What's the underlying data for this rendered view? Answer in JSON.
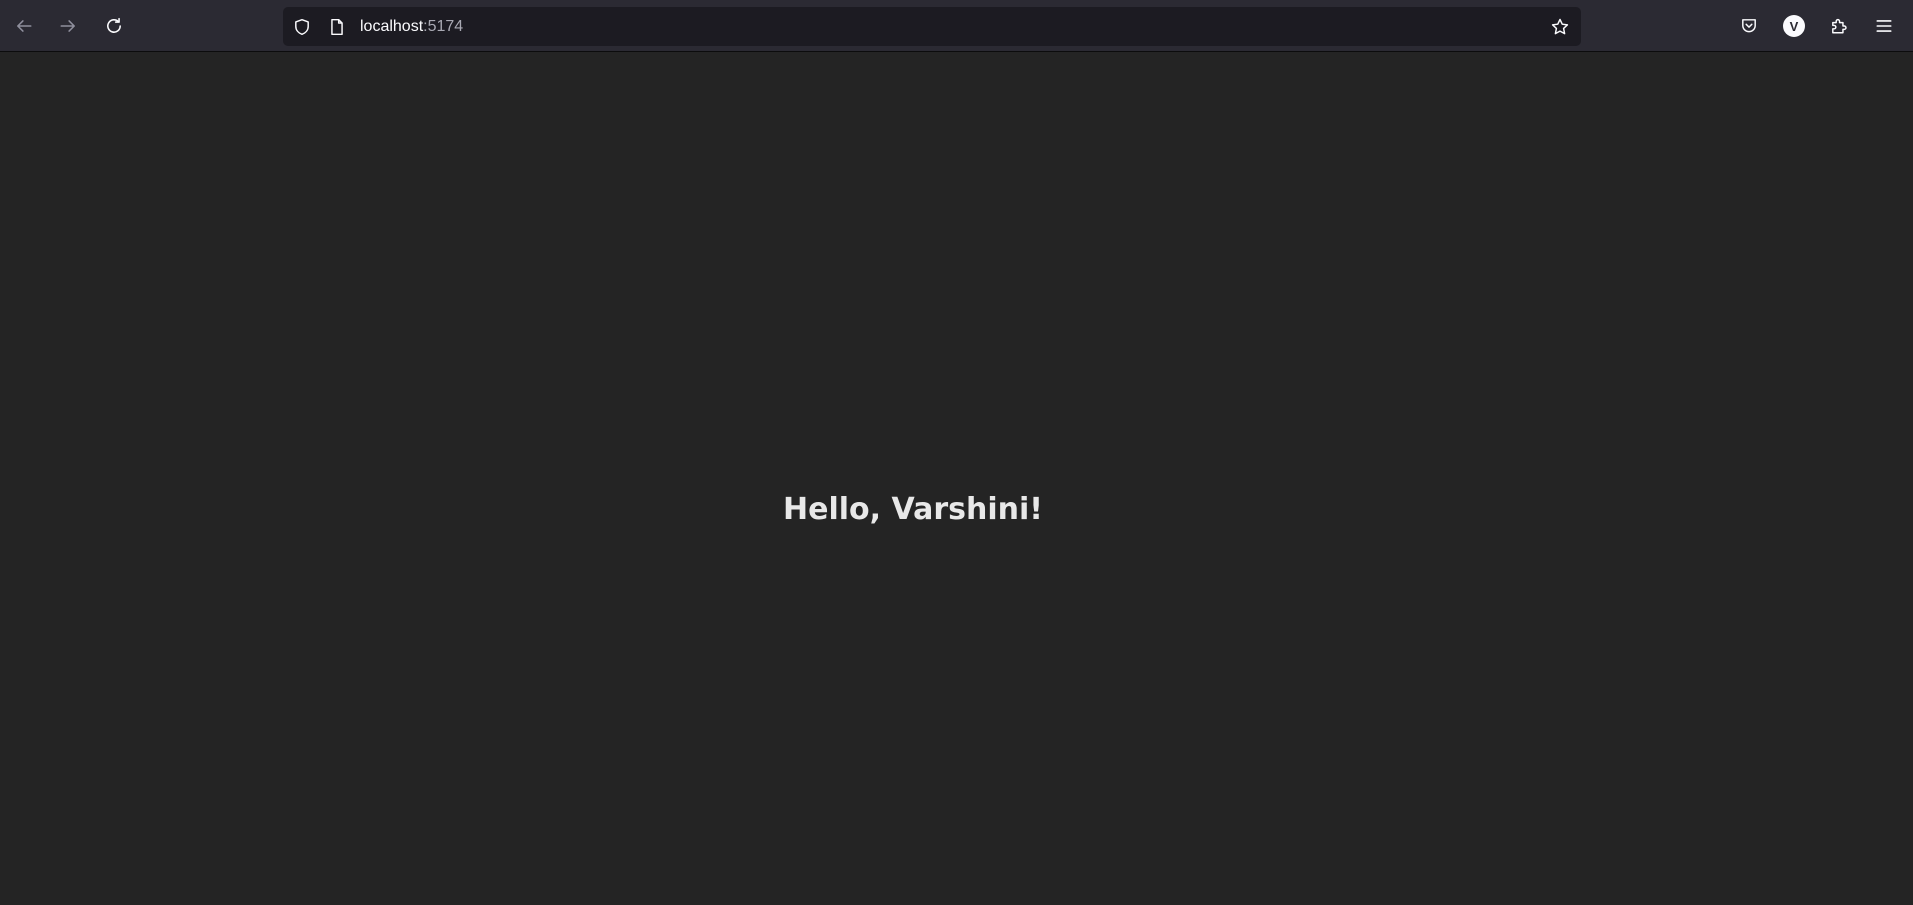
{
  "browser": {
    "url_host": "localhost",
    "url_port": ":5174",
    "profile_initial": "V",
    "icons": {
      "back": "back-arrow-icon",
      "forward": "forward-arrow-icon",
      "reload": "reload-icon",
      "shield": "shield-icon",
      "page": "page-icon",
      "bookmark": "star-icon",
      "pocket": "pocket-icon",
      "extensions": "puzzle-icon",
      "menu": "hamburger-menu-icon"
    }
  },
  "page": {
    "greeting": "Hello, Varshini!"
  },
  "colors": {
    "toolbar": "#2b2a33",
    "urlbar": "#1c1b22",
    "page_bg": "#242424",
    "text": "#e8e8e8"
  }
}
